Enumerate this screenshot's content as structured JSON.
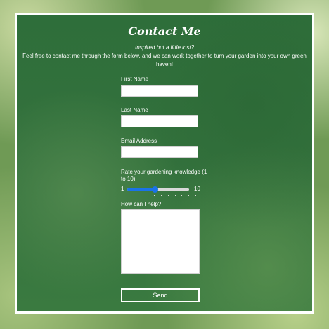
{
  "form": {
    "title": "Contact Me",
    "tagline": "Inspired but a little lost?",
    "intro": "Feel free to contact me through the form below, and we can work together to turn your garden into your own green haven!",
    "first_name_label": "First Name",
    "first_name_value": "",
    "last_name_label": "Last Name",
    "last_name_value": "",
    "email_label": "Email Address",
    "email_value": "",
    "rating_label": "Rate your gardening knowledge (1 to 10):",
    "rating_min": "1",
    "rating_max": "10",
    "rating_value": 5,
    "help_label": "How can I help?",
    "help_value": "",
    "send_label": "Send"
  },
  "colors": {
    "panel_green": "#34723d",
    "slider_accent": "#1a73e8",
    "text": "#ffffff"
  }
}
